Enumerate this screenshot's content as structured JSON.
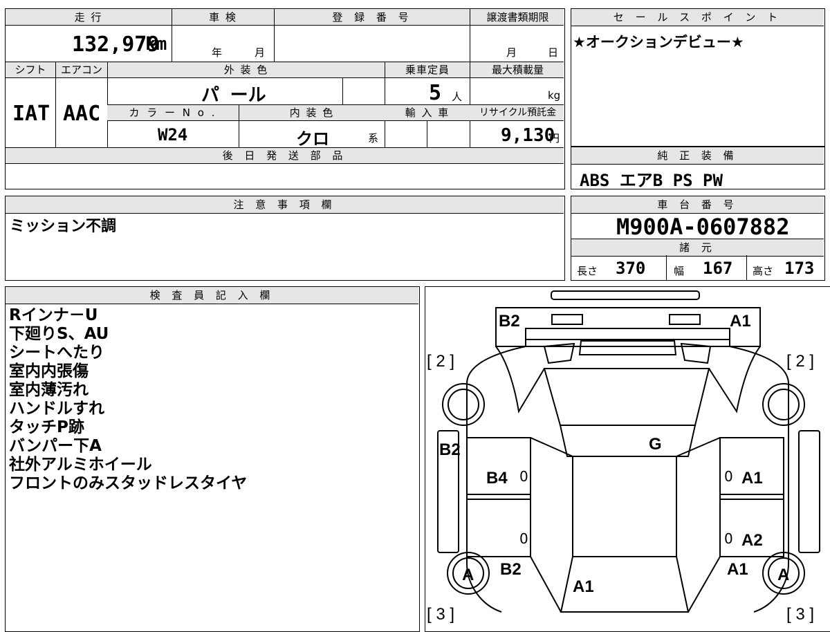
{
  "mileage_block": {
    "mileage_label": "走 行",
    "mileage_value": "132,979",
    "mileage_unit": "km",
    "inspection_label": "車 検",
    "inspection_year": "年",
    "inspection_month": "月",
    "registration_label": "登 録 番 号",
    "transfer_label": "譲渡書類期限",
    "transfer_month": "月",
    "transfer_day": "日"
  },
  "spec_block": {
    "shift_label": "シフト",
    "shift_value": "IAT",
    "ac_label": "エアコン",
    "ac_value": "AAC",
    "exterior_label": "外 装 色",
    "exterior_value": "パ ール",
    "capacity_label": "乗車定員",
    "capacity_value": "5",
    "capacity_unit": "人",
    "load_label": "最大積載量",
    "load_unit": "kg",
    "color_no_label": "カ ラ ー N o .",
    "color_no_value": "W24",
    "interior_label": "内 装 色",
    "interior_value": "クロ",
    "interior_suffix": "系",
    "import_label": "輸 入 車",
    "recycle_label": "リサイクル預託金",
    "recycle_value": "9,130",
    "recycle_unit": "円",
    "later_parts_label": "後 日 発 送 部 品"
  },
  "sales_point": {
    "label": "セ ー ル ス ポ イ ン ト",
    "text": "★オークションデビュー★"
  },
  "genuine_equipment": {
    "label": "純 正 装 備",
    "text": "ABS エアB PS PW"
  },
  "caution": {
    "label": "注 意 事 項 欄",
    "text": "ミッション不調"
  },
  "chassis": {
    "label": "車 台 番 号",
    "value": "M900A-0607882",
    "dims_label": "諸 元",
    "length_label": "長さ",
    "length_value": "370",
    "width_label": "幅",
    "width_value": "167",
    "height_label": "高さ",
    "height_value": "173"
  },
  "inspector": {
    "label": "検 査 員 記 入 欄",
    "notes": [
      "Rインナ－U",
      "下廻りS、AU",
      "シートへたり",
      "室内内張傷",
      "室内薄汚れ",
      "ハンドルすれ",
      "タッチP跡",
      "バンパー下A",
      "社外アルミホイール",
      "フロントのみスタッドレスタイヤ"
    ]
  },
  "car_diagram": {
    "marks": {
      "front_left": "B2",
      "front_right": "A1",
      "bracket_left_top": "[ 2 ]",
      "bracket_right_top": "[ 2 ]",
      "bracket_left_bottom": "[ 3 ]",
      "bracket_right_bottom": "[ 3 ]",
      "left_fender": "B2",
      "roof": "G",
      "left_front_door": "B4",
      "right_front_door": "A1",
      "right_rear_door": "A2",
      "left_wheel": "A",
      "right_wheel": "A",
      "left_rear": "B2",
      "right_rear": "A1",
      "rear_center": "A1",
      "zero_1": "0",
      "zero_2": "0",
      "zero_3": "0",
      "zero_4": "0"
    }
  }
}
